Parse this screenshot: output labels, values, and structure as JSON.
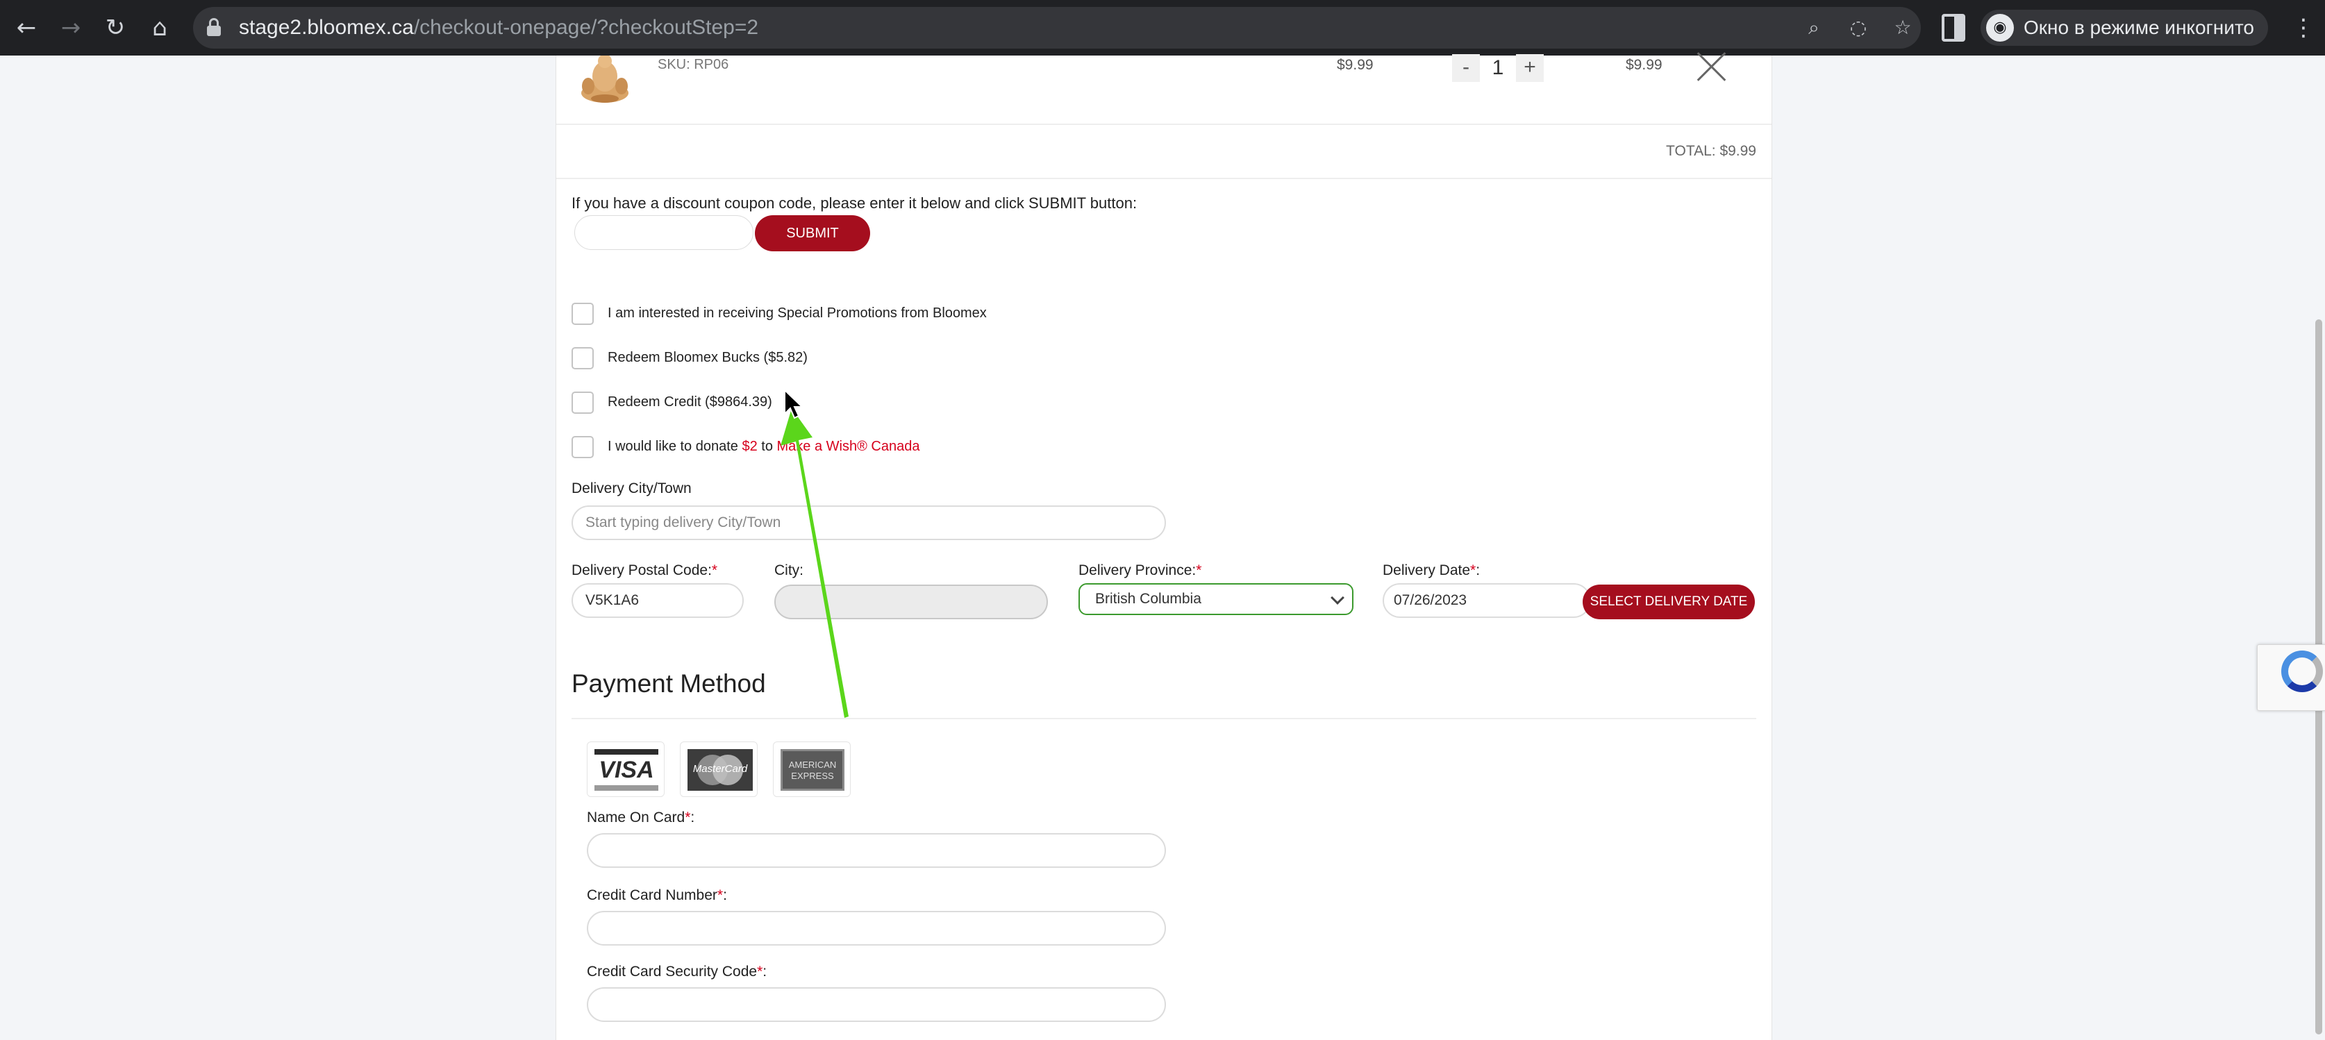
{
  "browser": {
    "url_host": "stage2.bloomex.ca",
    "url_path": "/checkout-onepage/?checkoutStep=2",
    "incognito_label": "Окно в режиме инкогнито"
  },
  "cart": {
    "sku": "SKU: RP06",
    "price": "$9.99",
    "qty_minus": "-",
    "quantity": "1",
    "qty_plus": "+",
    "line_total": "$9.99",
    "total": "TOTAL: $9.99"
  },
  "coupon": {
    "label": "If you have a discount coupon code, please enter it below and click SUBMIT button:",
    "value": "",
    "submit_label": "SUBMIT"
  },
  "options": {
    "promotions": "I am interested in receiving Special Promotions from Bloomex",
    "bucks": "Redeem Bloomex Bucks ($5.82)",
    "credit": "Redeem Credit ($9864.39)",
    "donate_prefix": "I would like to donate ",
    "donate_amount": "$2",
    "donate_mid": " to ",
    "donate_org": "Make a Wish® Canada"
  },
  "delivery": {
    "city_town_label": "Delivery City/Town",
    "city_town_placeholder": "Start typing delivery City/Town",
    "postal_label": "Delivery Postal Code:",
    "postal_value": "V5K1A6",
    "city_label": "City:",
    "city_value": "",
    "province_label": "Delivery Province:",
    "province_value": "British Columbia",
    "date_label": "Delivery Date",
    "date_label_suffix": ":",
    "date_value": "07/26/2023",
    "date_button": "SELECT DELIVERY DATE",
    "required_mark": "*"
  },
  "payment": {
    "title": "Payment Method",
    "visa": "VISA",
    "mastercard": "MasterCard",
    "amex": "AMERICAN EXPRESS",
    "name_label": "Name On Card",
    "number_label": "Credit Card Number",
    "cvv_label": "Credit Card Security Code",
    "label_colon": ":",
    "required_mark": "*"
  },
  "colors": {
    "brand_red": "#a50e1e",
    "required_red": "#d6001c",
    "select_border": "#3c9a2e",
    "annotation_arrow": "#5bd61b"
  },
  "icons": [
    "back-arrow-icon",
    "forward-arrow-icon",
    "reload-icon",
    "home-icon",
    "lock-icon",
    "zoom-icon",
    "eye-off-icon",
    "star-icon",
    "side-panel-icon",
    "incognito-icon",
    "menu-dots-icon",
    "close-icon",
    "chevron-down-icon",
    "recaptcha-icon",
    "mouse-cursor-icon"
  ]
}
